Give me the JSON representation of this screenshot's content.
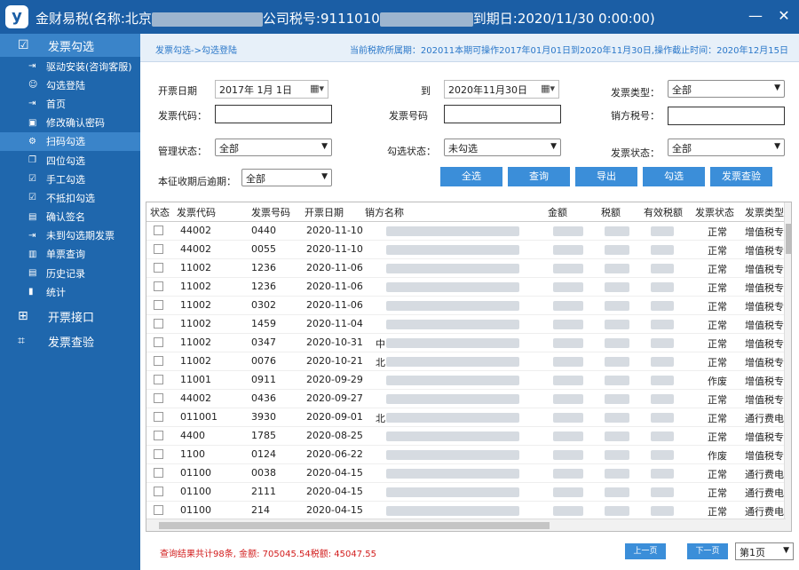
{
  "window": {
    "title_prefix": "金财易税(名称:北京",
    "title_mid": "公司税号:9111010",
    "title_suffix": "到期日:2020/11/30 0:00:00)",
    "logo": "y",
    "minimize": "—",
    "close": "✕"
  },
  "sidebar": {
    "top_items": [
      {
        "label": "发票勾选",
        "icon": "checkbox-icon"
      }
    ],
    "sub_items": [
      {
        "label": "驱动安装(咨询客服)",
        "icon": "login-icon"
      },
      {
        "label": "勾选登陆",
        "icon": "user-icon"
      },
      {
        "label": "首页",
        "icon": "login-icon"
      },
      {
        "label": "修改确认密码",
        "icon": "lock-icon"
      },
      {
        "label": "扫码勾选",
        "icon": "gear-icon"
      },
      {
        "label": "四位勾选",
        "icon": "copy-icon"
      },
      {
        "label": "手工勾选",
        "icon": "checkbox-icon"
      },
      {
        "label": "不抵扣勾选",
        "icon": "checkbox-icon"
      },
      {
        "label": "确认签名",
        "icon": "document-icon"
      },
      {
        "label": "未到勾选期发票",
        "icon": "login-icon"
      },
      {
        "label": "单票查询",
        "icon": "file-search-icon"
      },
      {
        "label": "历史记录",
        "icon": "document-icon"
      },
      {
        "label": "统计",
        "icon": "bar-chart-icon"
      }
    ],
    "bottom_items": [
      {
        "label": "开票接口",
        "icon": "grid-icon"
      },
      {
        "label": "发票查验",
        "icon": "scan-icon"
      }
    ]
  },
  "breadcrumb": "发票勾选->勾选登陆",
  "period_note": "当前税款所属期：202011本期可操作2017年01月01日到2020年11月30日,操作截止时间：2020年12月15日",
  "form": {
    "start_date_label": "开票日期",
    "start_date": "2017年  1月  1日",
    "to_label": "到",
    "end_date": "2020年11月30日",
    "invoice_type_label": "发票类型：",
    "invoice_type": "全部",
    "invoice_code_label": "发票代码：",
    "invoice_code": "",
    "invoice_no_label": "发票号码",
    "invoice_no": "",
    "seller_tax_label": "销方税号：",
    "seller_tax": "",
    "mgmt_status_label": "管理状态：",
    "mgmt_status": "全部",
    "check_status_label": "勾选状态：",
    "check_status": "未勾选",
    "invoice_status_label": "发票状态：",
    "invoice_status": "全部",
    "overdue_label": "本征收期后逾期：",
    "overdue": "全部"
  },
  "buttons": {
    "select_all": "全选",
    "query": "查询",
    "export": "导出",
    "check": "勾选",
    "verify": "发票查验"
  },
  "table": {
    "headers": [
      "状态",
      "发票代码",
      "发票号码",
      "开票日期",
      "销方名称",
      "金额",
      "税额",
      "有效税额",
      "发票状态",
      "发票类型"
    ],
    "rows": [
      {
        "code": "44002",
        "no": "0440",
        "date": "2020-11-10",
        "name": "",
        "status": "正常",
        "type": "增值税专"
      },
      {
        "code": "44002",
        "no": "0055",
        "date": "2020-11-10",
        "name": "",
        "status": "正常",
        "type": "增值税专"
      },
      {
        "code": "11002",
        "no": "1236",
        "date": "2020-11-06",
        "name": "",
        "status": "正常",
        "type": "增值税专"
      },
      {
        "code": "11002",
        "no": "1236",
        "date": "2020-11-06",
        "name": "",
        "status": "正常",
        "type": "增值税专"
      },
      {
        "code": "11002",
        "no": "0302",
        "date": "2020-11-06",
        "name": "",
        "status": "正常",
        "type": "增值税专"
      },
      {
        "code": "11002",
        "no": "1459",
        "date": "2020-11-04",
        "name": "",
        "status": "正常",
        "type": "增值税专"
      },
      {
        "code": "11002",
        "no": "0347",
        "date": "2020-10-31",
        "name": "中",
        "status": "正常",
        "type": "增值税专"
      },
      {
        "code": "11002",
        "no": "0076",
        "date": "2020-10-21",
        "name": "北",
        "status": "正常",
        "type": "增值税专"
      },
      {
        "code": "11001",
        "no": "0911",
        "date": "2020-09-29",
        "name": "",
        "status": "作废",
        "type": "增值税专"
      },
      {
        "code": "44002",
        "no": "0436",
        "date": "2020-09-27",
        "name": "",
        "status": "正常",
        "type": "增值税专"
      },
      {
        "code": "011001",
        "no": "3930",
        "date": "2020-09-01",
        "name": "北",
        "status": "正常",
        "type": "通行费电"
      },
      {
        "code": "4400",
        "no": "1785",
        "date": "2020-08-25",
        "name": "",
        "status": "正常",
        "type": "增值税专"
      },
      {
        "code": "1100",
        "no": "0124",
        "date": "2020-06-22",
        "name": "",
        "status": "作废",
        "type": "增值税专"
      },
      {
        "code": "01100",
        "no": "0038",
        "date": "2020-04-15",
        "name": "",
        "status": "正常",
        "type": "通行费电"
      },
      {
        "code": "01100",
        "no": "2111",
        "date": "2020-04-15",
        "name": "",
        "status": "正常",
        "type": "通行费电"
      },
      {
        "code": "01100",
        "no": "214",
        "date": "2020-04-15",
        "name": "",
        "status": "正常",
        "type": "通行费电"
      }
    ]
  },
  "footer": {
    "summary": "查询结果共计98条, 金额: 705045.54税额: 45047.55",
    "prev": "上一页",
    "next": "下一页",
    "page": "第1页"
  }
}
